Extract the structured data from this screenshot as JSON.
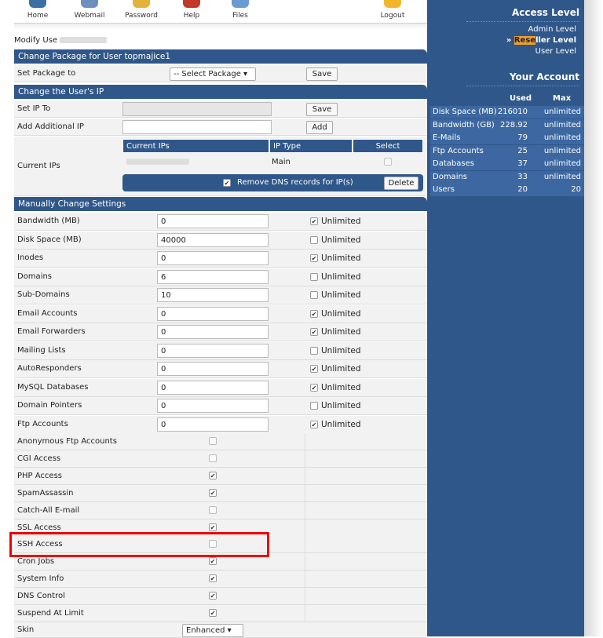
{
  "nav": [
    {
      "label": "Home",
      "color": "#3a6ea5"
    },
    {
      "label": "Webmail",
      "color": "#6c8fc0"
    },
    {
      "label": "Password",
      "color": "#e2b33a"
    },
    {
      "label": "Help",
      "color": "#c0392b"
    },
    {
      "label": "Files",
      "color": "#6a9bd0"
    },
    {
      "label": "Logout",
      "color": "#f1b72c"
    }
  ],
  "modify_label": "Modify Use",
  "package": {
    "header": "Change Package for User topmajice1",
    "label": "Set Package to",
    "select": "-- Select Package",
    "save": "Save"
  },
  "ip": {
    "header": "Change the User's IP",
    "set_label": "Set IP To",
    "save": "Save",
    "add_label": "Add Additional IP",
    "add": "Add",
    "current_label": "Current IPs",
    "col_current": "Current IPs",
    "col_type": "IP Type",
    "col_select": "Select",
    "row_type": "Main",
    "dns_text": "Remove DNS records for IP(s)",
    "delete": "Delete"
  },
  "manual": {
    "header": "Manually Change Settings",
    "unlimited": "Unlimited",
    "fields": [
      {
        "label": "Bandwidth (MB)",
        "value": "0",
        "unlimited": true
      },
      {
        "label": "Disk Space (MB)",
        "value": "40000",
        "unlimited": false
      },
      {
        "label": "Inodes",
        "value": "0",
        "unlimited": true
      },
      {
        "label": "Domains",
        "value": "6",
        "unlimited": false
      },
      {
        "label": "Sub-Domains",
        "value": "10",
        "unlimited": false
      },
      {
        "label": "Email Accounts",
        "value": "0",
        "unlimited": true
      },
      {
        "label": "Email Forwarders",
        "value": "0",
        "unlimited": true
      },
      {
        "label": "Mailing Lists",
        "value": "0",
        "unlimited": false
      },
      {
        "label": "AutoResponders",
        "value": "0",
        "unlimited": true
      },
      {
        "label": "MySQL Databases",
        "value": "0",
        "unlimited": true
      },
      {
        "label": "Domain Pointers",
        "value": "0",
        "unlimited": false
      },
      {
        "label": "Ftp Accounts",
        "value": "0",
        "unlimited": true
      }
    ],
    "toggles": [
      {
        "label": "Anonymous Ftp Accounts",
        "checked": false
      },
      {
        "label": "CGI Access",
        "checked": false
      },
      {
        "label": "PHP Access",
        "checked": true
      },
      {
        "label": "SpamAssassin",
        "checked": true
      },
      {
        "label": "Catch-All E-mail",
        "checked": false
      },
      {
        "label": "SSL Access",
        "checked": true
      },
      {
        "label": "SSH Access",
        "checked": false
      },
      {
        "label": "Cron Jobs",
        "checked": true
      },
      {
        "label": "System Info",
        "checked": true
      },
      {
        "label": "DNS Control",
        "checked": true
      },
      {
        "label": "Suspend At Limit",
        "checked": true
      }
    ],
    "skin_label": "Skin",
    "skin_value": "Enhanced"
  },
  "sidebar": {
    "access_title": "Access Level",
    "levels": [
      "Admin Level",
      "Reseller Level",
      "User Level"
    ],
    "reseller_highlight": "Rese",
    "reseller_rest": "ller Level",
    "account_title": "Your Account",
    "col_used": "Used",
    "col_max": "Max",
    "stats": [
      {
        "name": "Disk Space (MB)",
        "used": "216010",
        "max": "unlimited"
      },
      {
        "name": "Bandwidth (GB)",
        "used": "228.92",
        "max": "unlimited"
      },
      {
        "name": "E-Mails",
        "used": "79",
        "max": "unlimited"
      },
      {
        "name": "Ftp Accounts",
        "used": "25",
        "max": "unlimited"
      },
      {
        "name": "Databases",
        "used": "37",
        "max": "unlimited"
      },
      {
        "name": "Domains",
        "used": "33",
        "max": "unlimited"
      },
      {
        "name": "Users",
        "used": "20",
        "max": "20"
      }
    ]
  }
}
